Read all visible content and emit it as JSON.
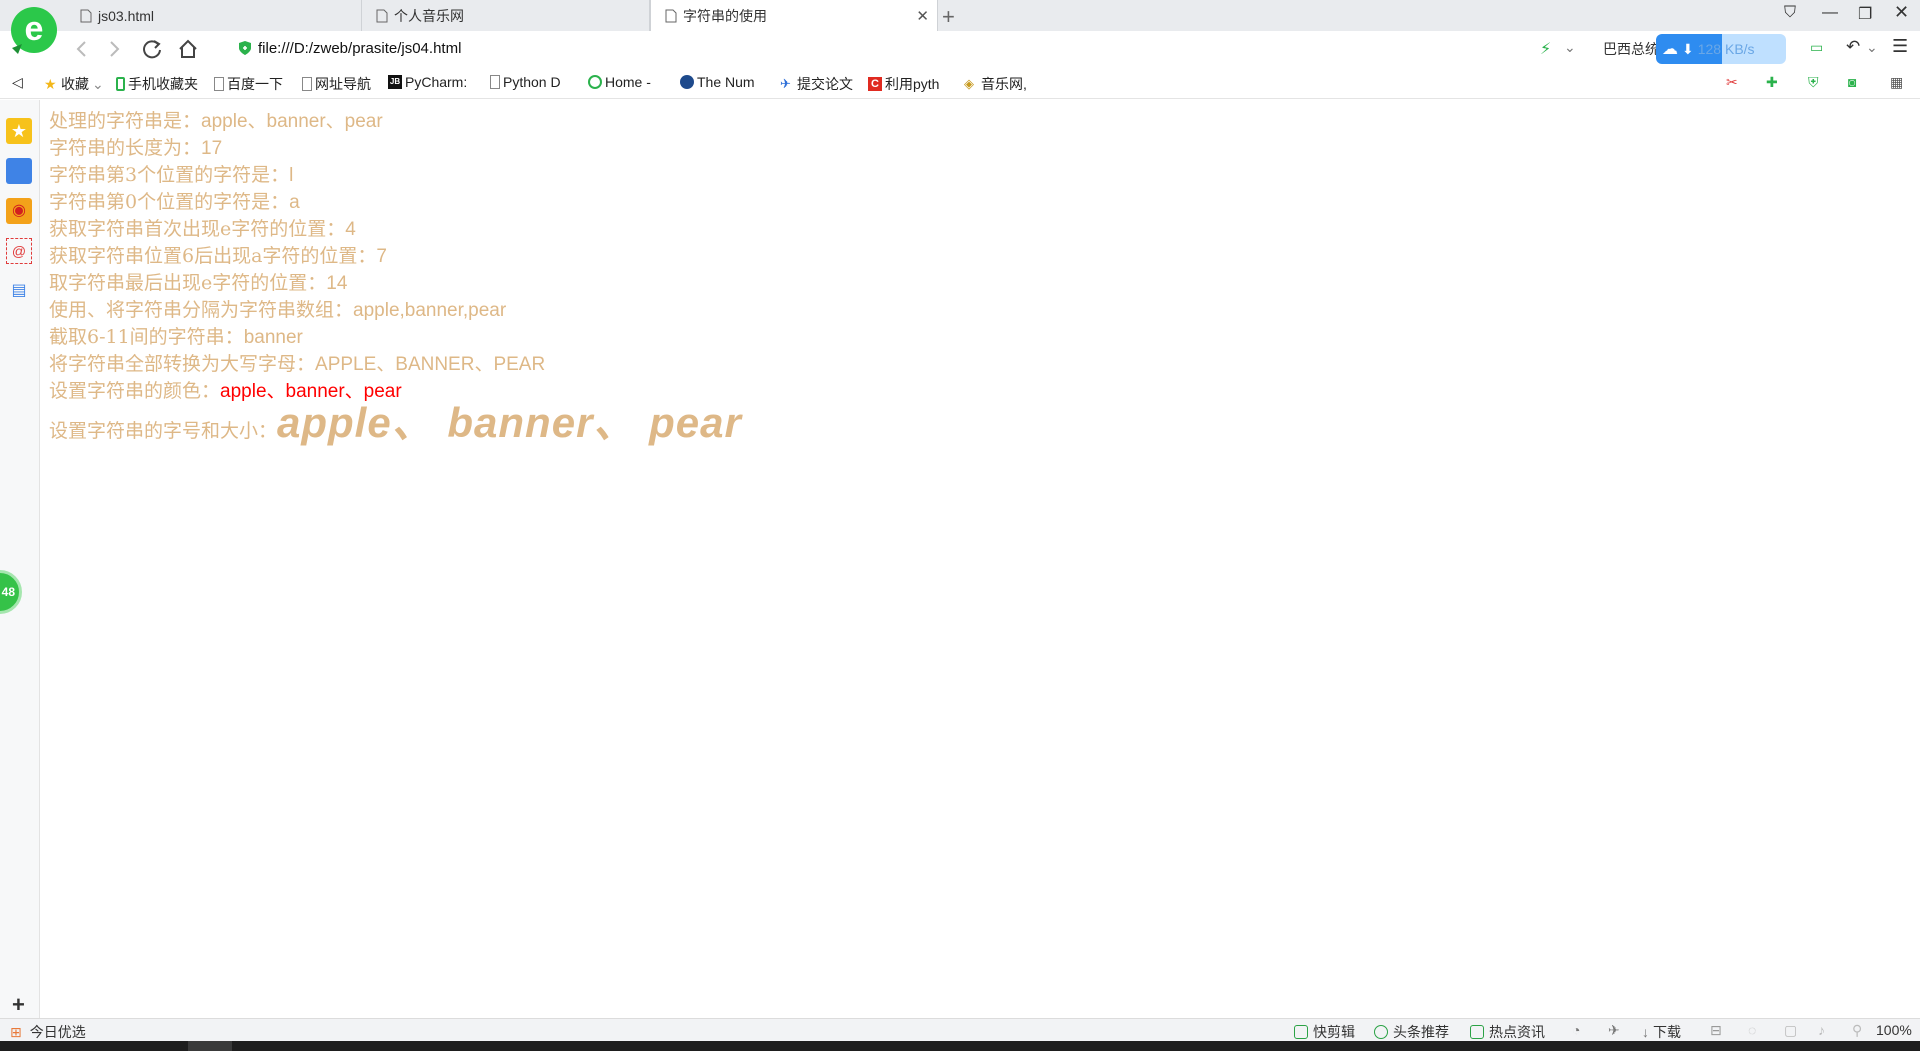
{
  "browser": {
    "tabs": [
      {
        "label": "js03.html",
        "active": false
      },
      {
        "label": "个人音乐网",
        "active": false
      },
      {
        "label": "字符串的使用",
        "active": true
      }
    ],
    "url": "file:///D:/zweb/prasite/js04.html",
    "search_hint": "巴西总统",
    "download_speed": "128 KB/s",
    "accent_color": "#2e8cf0"
  },
  "bookmarks": [
    {
      "label": "收藏",
      "icon": "star-icon"
    },
    {
      "label": "手机收藏夹",
      "icon": "phone-icon"
    },
    {
      "label": "百度一下",
      "icon": "page-icon"
    },
    {
      "label": "网址导航",
      "icon": "page-icon"
    },
    {
      "label": "PyCharm:",
      "icon": "jetbrains-icon"
    },
    {
      "label": "Python D",
      "icon": "page-icon"
    },
    {
      "label": "Home -",
      "icon": "circle-icon"
    },
    {
      "label": "The Num",
      "icon": "numpy-icon"
    },
    {
      "label": "提交论文",
      "icon": "paper-icon"
    },
    {
      "label": "利用pyth",
      "icon": "csdn-icon"
    },
    {
      "label": "音乐网,",
      "icon": "music-icon"
    }
  ],
  "content": {
    "lines": [
      {
        "label": "处理的字符串是：",
        "value": "apple、banner、pear"
      },
      {
        "label": "字符串的长度为：",
        "value": "17"
      },
      {
        "label": "字符串第3个位置的字符是：",
        "value": "l"
      },
      {
        "label": "字符串第0个位置的字符是：",
        "value": "a"
      },
      {
        "label": "获取字符串首次出现e字符的位置：",
        "value": "4"
      },
      {
        "label": "获取字符串位置6后出现a字符的位置：",
        "value": "7"
      },
      {
        "label": "取字符串最后出现e字符的位置：",
        "value": "14"
      },
      {
        "label": "使用、将字符串分隔为字符串数组：",
        "value": "apple,banner,pear"
      },
      {
        "label": "截取6-11间的字符串：",
        "value": "banner"
      },
      {
        "label": "将字符串全部转换为大写字母：",
        "value": "APPLE、BANNER、PEAR"
      }
    ],
    "color_line": {
      "label": "设置字符串的颜色：",
      "value": "apple、banner、pear",
      "color": "#ff0000"
    },
    "size_line": {
      "label": "设置字符串的字号和大小：",
      "value": "apple、 banner、 pear"
    },
    "text_color": "#deb887"
  },
  "sidebar": {
    "badge_count": "48"
  },
  "statusbar": {
    "left": "今日优选",
    "items": [
      "快剪辑",
      "头条推荐",
      "热点资讯"
    ],
    "download": "下载",
    "zoom": "100%"
  }
}
